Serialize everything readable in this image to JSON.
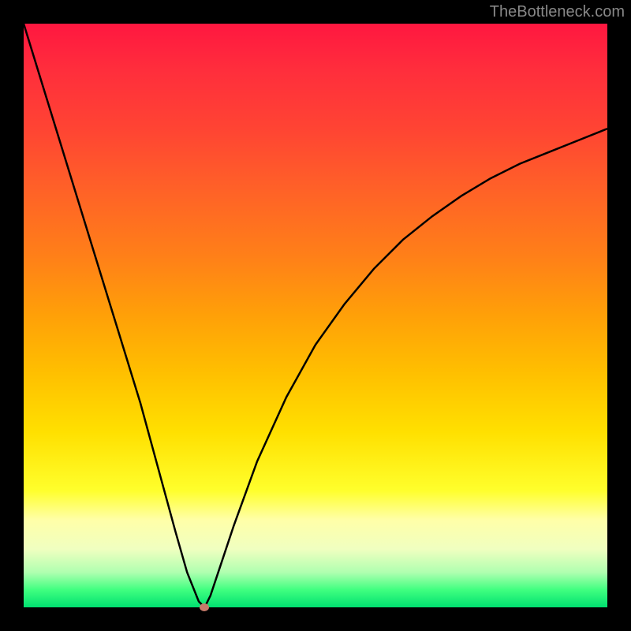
{
  "watermark": "TheBottleneck.com",
  "chart_data": {
    "type": "line",
    "title": "",
    "xlabel": "",
    "ylabel": "",
    "xlim": [
      0,
      100
    ],
    "ylim": [
      0,
      100
    ],
    "description": "Bottleneck V-curve on vertical rainbow gradient (red=high bottleneck, green=low bottleneck). Curve descends steeply from top-left, reaches minimum near x≈30, then rises asymptotically toward upper-right.",
    "series": [
      {
        "name": "bottleneck-curve",
        "x": [
          0,
          4,
          8,
          12,
          16,
          20,
          23,
          26,
          28,
          30,
          31,
          32,
          34,
          36,
          40,
          45,
          50,
          55,
          60,
          65,
          70,
          75,
          80,
          85,
          90,
          95,
          100
        ],
        "values": [
          100,
          87,
          74,
          61,
          48,
          35,
          24,
          13,
          6,
          1,
          0,
          2,
          8,
          14,
          25,
          36,
          45,
          52,
          58,
          63,
          67,
          70.5,
          73.5,
          76,
          78,
          80,
          82
        ]
      }
    ],
    "marker": {
      "x": 31,
      "y": 0,
      "color": "#c77a6a"
    },
    "gradient_stops": [
      {
        "pos": 0,
        "color": "#ff1740"
      },
      {
        "pos": 50,
        "color": "#ffa008"
      },
      {
        "pos": 80,
        "color": "#ffff2c"
      },
      {
        "pos": 100,
        "color": "#00e070"
      }
    ]
  }
}
